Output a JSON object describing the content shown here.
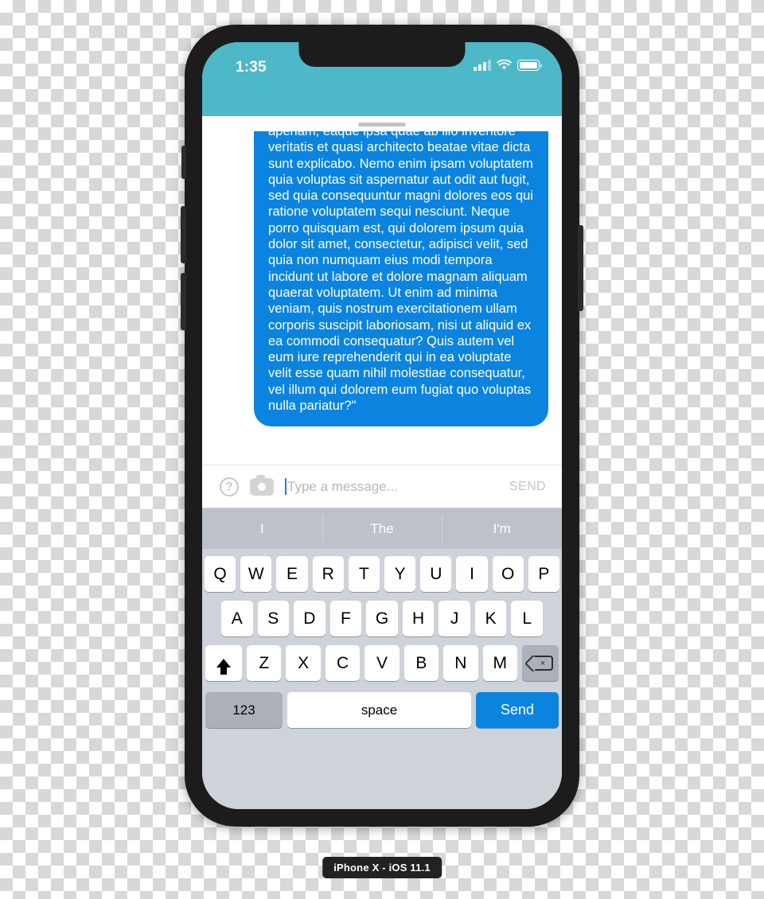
{
  "device": {
    "caption": "iPhone X - iOS 11.1"
  },
  "status_bar": {
    "time": "1:35",
    "signal_icon": "cellular-signal-icon",
    "wifi_icon": "wifi-icon",
    "battery_icon": "battery-icon"
  },
  "conversation": {
    "handle_name": "drag-handle",
    "bubble_text": "aperiam, eaque ipsa quae ab illo inventore veritatis et quasi architecto beatae vitae dicta sunt explicabo. Nemo enim ipsam voluptatem quia voluptas sit aspernatur aut odit aut fugit, sed quia consequuntur magni dolores eos qui ratione voluptatem sequi nesciunt. Neque porro quisquam est, qui dolorem ipsum quia dolor sit amet, consectetur, adipisci velit, sed quia non numquam eius modi tempora incidunt ut labore et dolore magnam aliquam quaerat voluptatem. Ut enim ad minima veniam, quis nostrum exercitationem ullam corporis suscipit laboriosam, nisi ut aliquid ex ea commodi consequatur? Quis autem vel eum iure reprehenderit qui in ea voluptate velit esse quam nihil molestiae consequatur, vel illum qui dolorem eum fugiat quo voluptas nulla pariatur?\"",
    "bubble_color": "#0b84e0"
  },
  "input_bar": {
    "help_icon": "?",
    "camera_icon": "camera-icon",
    "placeholder": "Type a message...",
    "value": "",
    "send_label": "SEND"
  },
  "predictions": [
    {
      "label": "I"
    },
    {
      "label": "The"
    },
    {
      "label": "I'm"
    }
  ],
  "keyboard": {
    "row1": [
      "Q",
      "W",
      "E",
      "R",
      "T",
      "Y",
      "U",
      "I",
      "O",
      "P"
    ],
    "row2": [
      "A",
      "S",
      "D",
      "F",
      "G",
      "H",
      "J",
      "K",
      "L"
    ],
    "row3": [
      "Z",
      "X",
      "C",
      "V",
      "B",
      "N",
      "M"
    ],
    "shift_icon": "shift-icon",
    "backspace_icon": "backspace-icon",
    "numbers_label": "123",
    "space_label": "space",
    "send_label": "Send"
  },
  "tray": {
    "emoji_icon": "emoji-icon",
    "mic_icon": "microphone-icon",
    "home_indicator": "home-indicator"
  },
  "colors": {
    "header_teal": "#4cb8c8",
    "bubble_blue": "#0b84e0",
    "keyboard_bg": "#ced2d9",
    "prediction_bg": "#bcc1ca"
  }
}
